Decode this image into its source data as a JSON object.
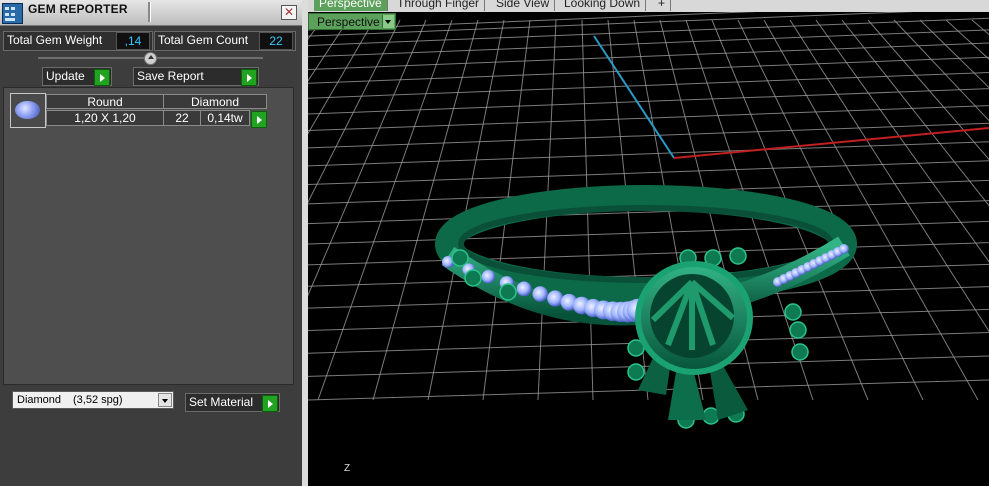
{
  "panel": {
    "title": "GEM REPORTER",
    "close_glyph": "✕",
    "total_weight_label": "Total Gem Weight",
    "total_weight_value": ",14",
    "total_count_label": "Total Gem Count",
    "total_count_value": "22",
    "update_label": "Update",
    "save_report_label": "Save Report"
  },
  "gem_table": {
    "shape": "Round",
    "material": "Diamond",
    "size": "1,20 X 1,20",
    "count": "22",
    "weight": "0,14tw"
  },
  "material_select": {
    "name": "Diamond",
    "density": "(3,52 spg)"
  },
  "set_material_label": "Set Material",
  "viewport": {
    "tabs": [
      "Perspective",
      "Through Finger",
      "Side View",
      "Looking Down",
      "+"
    ],
    "active_tab": "Perspective",
    "view_selector": "Perspective",
    "axis_label": "Z"
  },
  "colors": {
    "go_button": "#21a321",
    "active_tab": "#5ba05b",
    "value_text": "#38c8ff",
    "ring_metal": "#0f7a55",
    "gem": "#9fb4ff",
    "grid": "#9a9a9a",
    "axis_x": "#c22020",
    "axis_y": "#2a9ac6"
  },
  "icons": {
    "app": "gem-reporter-app-icon",
    "close": "close-icon",
    "go": "green-play-arrow-icon",
    "dropdown": "chevron-down-icon",
    "gem_thumbnail": "round-gem-icon"
  }
}
